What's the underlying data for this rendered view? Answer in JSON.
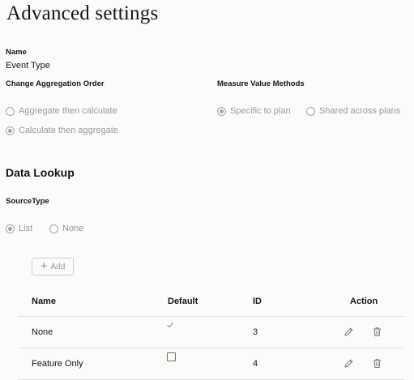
{
  "page": {
    "title": "Advanced settings"
  },
  "name_field": {
    "label": "Name",
    "value": "Event Type"
  },
  "aggregation": {
    "label": "Change Aggregation Order",
    "options": [
      {
        "label": "Aggregate then calculate",
        "selected": false
      },
      {
        "label": "Calculate then aggregate",
        "selected": true
      }
    ]
  },
  "measure": {
    "label": "Measure Value Methods",
    "options": [
      {
        "label": "Specific to plan",
        "selected": true
      },
      {
        "label": "Shared across plans",
        "selected": false
      }
    ]
  },
  "data_lookup": {
    "title": "Data Lookup",
    "source_type_label": "SourceType",
    "source_options": [
      {
        "label": "List",
        "selected": true
      },
      {
        "label": "None",
        "selected": false
      }
    ],
    "add_label": "Add"
  },
  "table": {
    "headers": {
      "name": "Name",
      "default": "Default",
      "id": "ID",
      "action": "Action"
    },
    "rows": [
      {
        "name": "None",
        "default": true,
        "id": "3"
      },
      {
        "name": "Feature Only",
        "default": false,
        "id": "4"
      }
    ]
  },
  "icons": {
    "add": "plus-icon",
    "edit": "pencil-icon",
    "delete": "trash-icon",
    "default_checked": "check-icon",
    "default_unchecked": "checkbox-icon"
  }
}
